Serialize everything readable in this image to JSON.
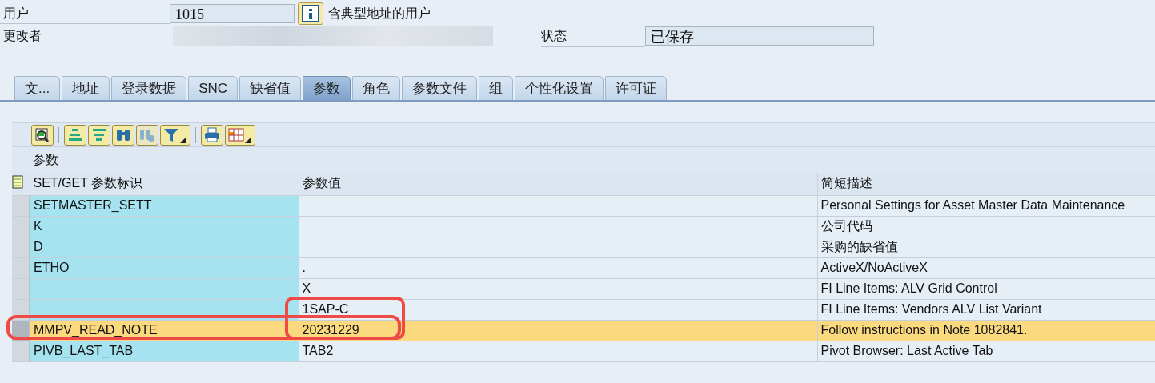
{
  "header": {
    "user_label": "用户",
    "user_value": "1015",
    "user_description": "含典型地址的用户",
    "changed_by_label": "更改者",
    "status_label": "状态",
    "status_value": "已保存"
  },
  "tabs": [
    {
      "label": "文...",
      "selected": false
    },
    {
      "label": "地址",
      "selected": false
    },
    {
      "label": "登录数据",
      "selected": false
    },
    {
      "label": "SNC",
      "selected": false
    },
    {
      "label": "缺省值",
      "selected": false
    },
    {
      "label": "参数",
      "selected": true
    },
    {
      "label": "角色",
      "selected": false
    },
    {
      "label": "参数文件",
      "selected": false
    },
    {
      "label": "组",
      "selected": false
    },
    {
      "label": "个性化设置",
      "selected": false
    },
    {
      "label": "许可证",
      "selected": false
    }
  ],
  "toolbar": [
    {
      "kind": "details",
      "disabled": false,
      "dropdown": false
    },
    {
      "kind": "sep"
    },
    {
      "kind": "sort-asc",
      "disabled": false,
      "dropdown": false
    },
    {
      "kind": "sort-desc",
      "disabled": false,
      "dropdown": false
    },
    {
      "kind": "find",
      "disabled": false,
      "dropdown": false
    },
    {
      "kind": "find-next",
      "disabled": true,
      "dropdown": false
    },
    {
      "kind": "filter",
      "disabled": false,
      "dropdown": true
    },
    {
      "kind": "sep"
    },
    {
      "kind": "print",
      "disabled": false,
      "dropdown": false
    },
    {
      "kind": "layout",
      "disabled": false,
      "dropdown": true
    }
  ],
  "section_title": "参数",
  "table": {
    "columns": [
      "SET/GET 参数标识",
      "参数值",
      "简短描述"
    ],
    "rows": [
      {
        "cells": [
          "SETMASTER_SETT",
          "",
          "Personal Settings for Asset Master Data Maintenance"
        ],
        "selected": false
      },
      {
        "cells": [
          "K",
          "",
          "公司代码"
        ],
        "selected": false
      },
      {
        "cells": [
          "D",
          "",
          "采购的缺省值"
        ],
        "selected": false
      },
      {
        "cells": [
          "ETHO",
          ".",
          "ActiveX/NoActiveX"
        ],
        "selected": false
      },
      {
        "cells": [
          "",
          "X",
          "FI Line Items: ALV Grid Control"
        ],
        "selected": false
      },
      {
        "cells": [
          "",
          "1SAP-C",
          "FI Line Items: Vendors ALV List Variant"
        ],
        "selected": false
      },
      {
        "cells": [
          "MMPV_READ_NOTE",
          "20231229",
          "Follow instructions in Note 1082841."
        ],
        "selected": true
      },
      {
        "cells": [
          "PIVB_LAST_TAB",
          "TAB2",
          "Pivot Browser: Last Active Tab"
        ],
        "selected": false
      }
    ]
  },
  "annotations": {
    "row_frame": true,
    "column_frame": true
  }
}
